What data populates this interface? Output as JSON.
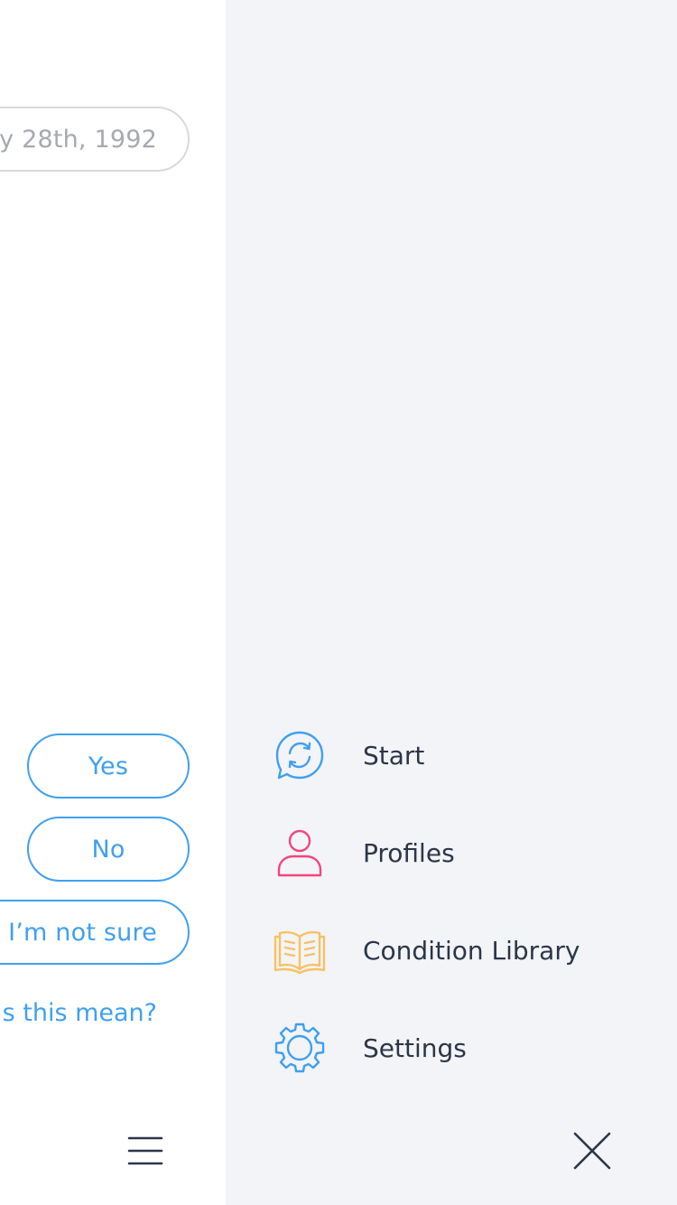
{
  "colors": {
    "accent": "#3fa0f0",
    "drawer_bg": "#f3f4f8",
    "text_dark": "#2b3648",
    "date_text": "#a6a9b0",
    "profiles_icon": "#f2467c",
    "library_icon": "#f7c163"
  },
  "chat": {
    "date_answer": "ay 28th, 1992",
    "answers": {
      "yes": "Yes",
      "no": "No",
      "unsure": "I’m not sure"
    },
    "meaning_link": "s this mean?",
    "menu_icon": "hamburger-icon"
  },
  "drawer": {
    "items": [
      {
        "label": "Start",
        "icon": "chat-refresh-icon"
      },
      {
        "label": "Profiles",
        "icon": "person-icon"
      },
      {
        "label": "Condition Library",
        "icon": "open-book-icon"
      },
      {
        "label": "Settings",
        "icon": "gear-icon"
      }
    ],
    "close_icon": "close-icon"
  }
}
